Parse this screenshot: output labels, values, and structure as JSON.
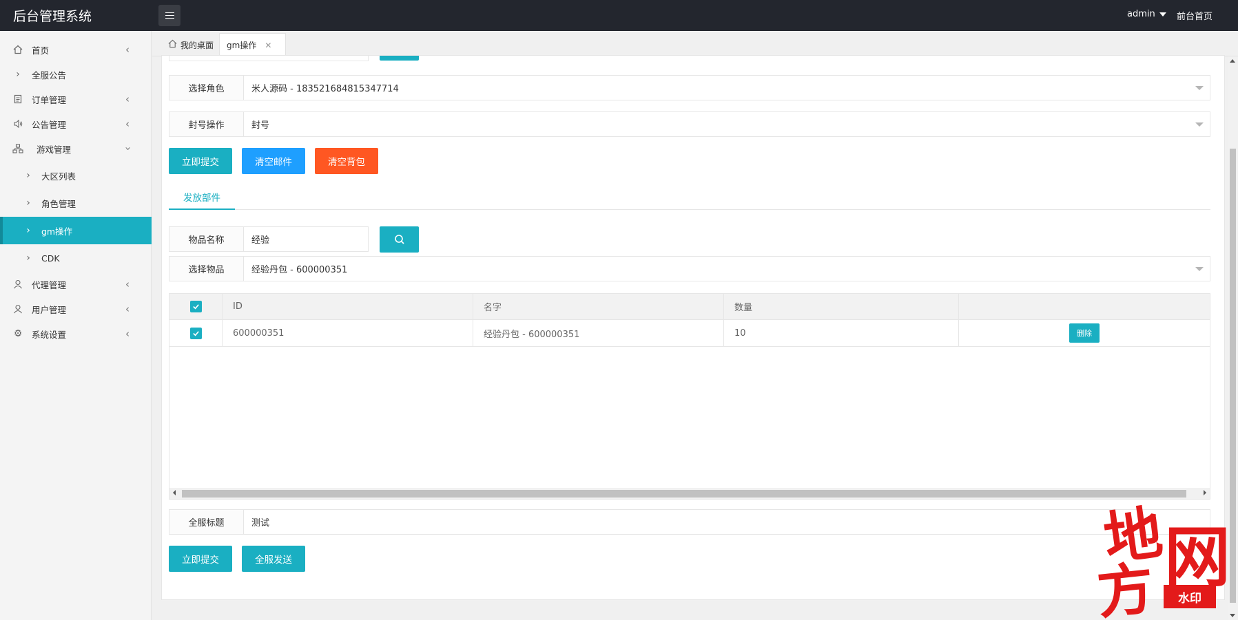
{
  "header": {
    "title": "后台管理系统",
    "user": "admin",
    "front_link": "前台首页"
  },
  "sidebar": {
    "items": [
      {
        "label": "首页",
        "icon": "home-icon"
      },
      {
        "label": "全服公告",
        "icon": "chevron-right-icon"
      },
      {
        "label": "订单管理",
        "icon": "document-icon"
      },
      {
        "label": "公告管理",
        "icon": "speaker-icon"
      },
      {
        "label": "游戏管理",
        "icon": "sitemap-icon"
      },
      {
        "label": "大区列表",
        "icon": "chevron-right-icon"
      },
      {
        "label": "角色管理",
        "icon": "chevron-right-icon"
      },
      {
        "label": "gm操作",
        "icon": "chevron-right-icon"
      },
      {
        "label": "CDK",
        "icon": "chevron-right-icon"
      },
      {
        "label": "代理管理",
        "icon": "user-icon"
      },
      {
        "label": "用户管理",
        "icon": "user-icon"
      },
      {
        "label": "系统设置",
        "icon": "gear-icon"
      }
    ]
  },
  "tabs": {
    "home": "我的桌面",
    "current": "gm操作"
  },
  "form": {
    "role_label": "选择角色",
    "role_value": "米人源码 - 183521684815347714",
    "ban_label": "封号操作",
    "ban_value": "封号",
    "submit": "立即提交",
    "clear_mail": "清空邮件",
    "clear_bag": "清空背包"
  },
  "mail": {
    "tab": "发放部件",
    "item_name_label": "物品名称",
    "item_name_value": "经验",
    "select_item_label": "选择物品",
    "select_item_value": "经验丹包 - 600000351",
    "table": {
      "headers": [
        "ID",
        "名字",
        "数量"
      ],
      "rows": [
        {
          "id": "600000351",
          "name": "经验丹包 - 600000351",
          "qty": "10",
          "action": "删除"
        }
      ]
    },
    "title_label": "全服标题",
    "title_value": "测试",
    "submit": "立即提交",
    "send_all": "全服发送"
  },
  "watermark": {
    "chars": [
      "地",
      "网",
      "方"
    ],
    "stamp": "水印"
  },
  "colors": {
    "accent": "#1aafc2",
    "blue": "#1e9fff",
    "orange": "#ff5722",
    "header_bg": "#23262e"
  }
}
